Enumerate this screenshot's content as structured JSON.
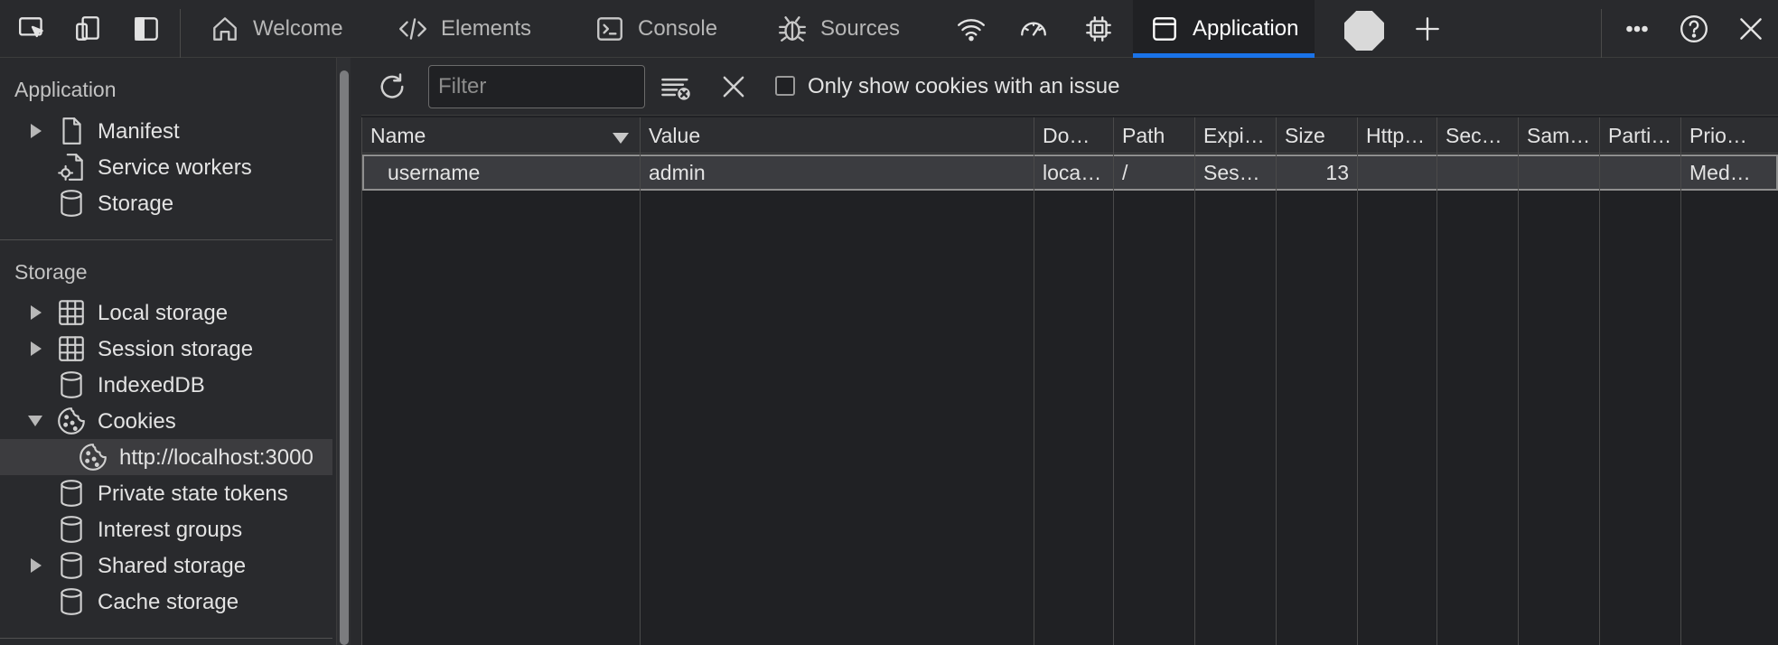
{
  "tabs": {
    "welcome": "Welcome",
    "elements": "Elements",
    "console": "Console",
    "sources": "Sources",
    "application": "Application"
  },
  "sidebar": {
    "application_title": "Application",
    "application_items": [
      {
        "label": "Manifest",
        "icon": "document-icon",
        "expandable": true
      },
      {
        "label": "Service workers",
        "icon": "gear-document-icon",
        "expandable": false
      },
      {
        "label": "Storage",
        "icon": "database-icon",
        "expandable": false
      }
    ],
    "storage_title": "Storage",
    "storage_items": [
      {
        "label": "Local storage",
        "icon": "grid-icon",
        "expandable": true
      },
      {
        "label": "Session storage",
        "icon": "grid-icon",
        "expandable": true
      },
      {
        "label": "IndexedDB",
        "icon": "database-icon",
        "expandable": false
      },
      {
        "label": "Cookies",
        "icon": "cookie-icon",
        "expanded": true
      },
      {
        "label": "http://localhost:3000",
        "icon": "cookie-icon",
        "selected": true
      },
      {
        "label": "Private state tokens",
        "icon": "database-icon",
        "expandable": false
      },
      {
        "label": "Interest groups",
        "icon": "database-icon",
        "expandable": false
      },
      {
        "label": "Shared storage",
        "icon": "database-icon",
        "expandable": true
      },
      {
        "label": "Cache storage",
        "icon": "database-icon",
        "expandable": false
      }
    ]
  },
  "toolbar": {
    "filter_placeholder": "Filter",
    "only_issues_label": "Only show cookies with an issue"
  },
  "table": {
    "columns": [
      "Name",
      "Value",
      "Do…",
      "Path",
      "Expi…",
      "Size",
      "Http…",
      "Sec…",
      "Sam…",
      "Parti…",
      "Prio…"
    ],
    "rows": [
      [
        "username",
        "admin",
        "loca…",
        "/",
        "Ses…",
        "13",
        "",
        "",
        "",
        "",
        "Med…"
      ]
    ]
  },
  "colors": {
    "accent": "#1a73e8",
    "background": "#202124",
    "panel": "#292a2d"
  }
}
